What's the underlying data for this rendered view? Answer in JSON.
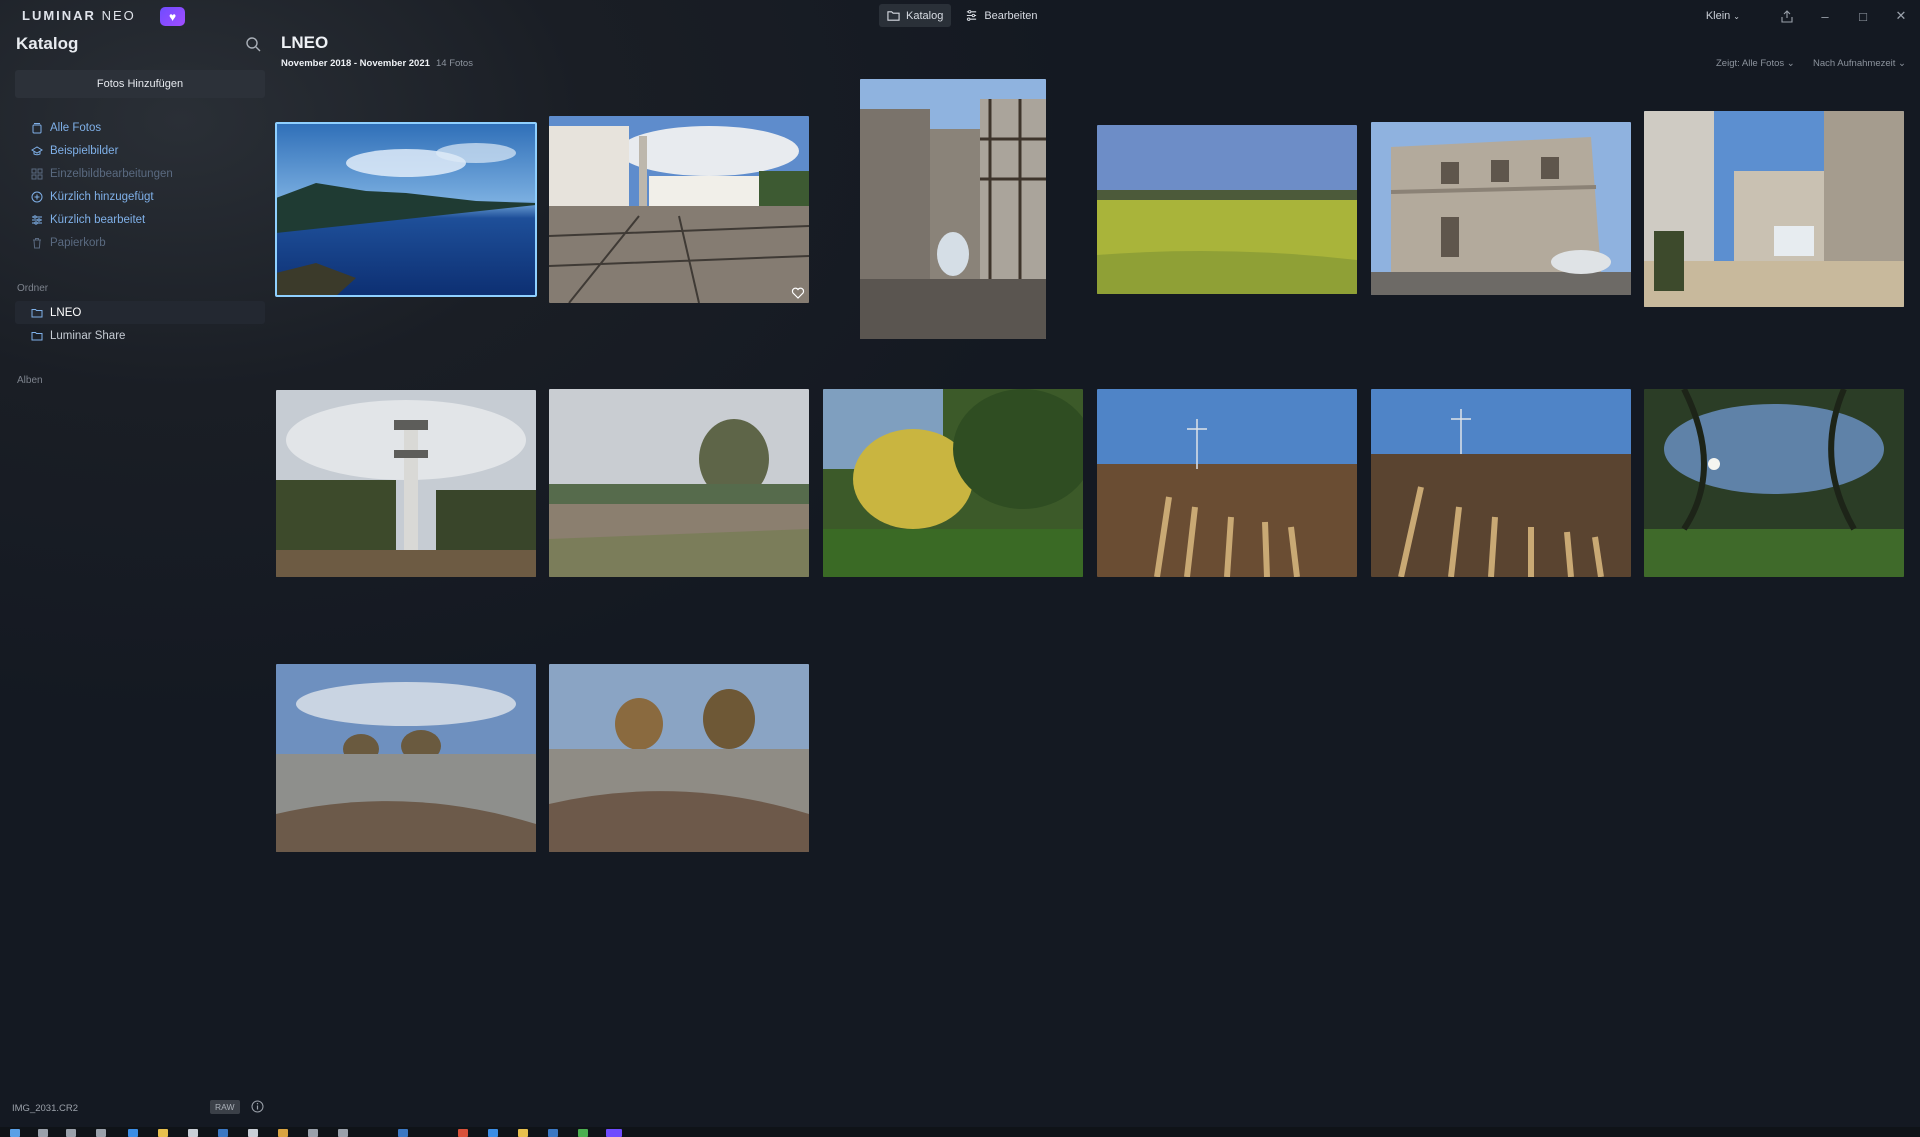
{
  "app": {
    "logo_main": "LUMINAR",
    "logo_neo": "NEO",
    "modes": [
      {
        "label": "Katalog",
        "icon": "folder-icon",
        "active": true
      },
      {
        "label": "Bearbeiten",
        "icon": "sliders-icon",
        "active": false
      }
    ],
    "view_size": "Klein",
    "window_controls": [
      "share-icon",
      "minimize-icon",
      "maximize-icon",
      "close-icon"
    ]
  },
  "sidebar": {
    "title": "Katalog",
    "add_button": "Fotos Hinzufügen",
    "nav_items": [
      {
        "label": "Alle Fotos",
        "icon": "stack-icon",
        "enabled": true
      },
      {
        "label": "Beispielbilder",
        "icon": "graduation-icon",
        "enabled": true
      },
      {
        "label": "Einzelbildbearbeitungen",
        "icon": "grid-icon",
        "enabled": false
      },
      {
        "label": "Kürzlich hinzugefügt",
        "icon": "plus-circle-icon",
        "enabled": true
      },
      {
        "label": "Kürzlich bearbeitet",
        "icon": "sliders-icon",
        "enabled": true
      },
      {
        "label": "Papierkorb",
        "icon": "trash-icon",
        "enabled": false
      }
    ],
    "folders_label": "Ordner",
    "folders": [
      {
        "label": "LNEO",
        "active": true
      },
      {
        "label": "Luminar Share",
        "active": false
      }
    ],
    "albums_label": "Alben",
    "status_file": "IMG_2031.CR2",
    "status_badge": "RAW"
  },
  "main": {
    "title": "LNEO",
    "date_range": "November 2018 - November 2021",
    "photo_count": "14 Fotos",
    "filter_label": "Zeigt: Alle Fotos",
    "sort_label": "Nach Aufnahmezeit",
    "photos": [
      {
        "name": "coast-cliffs",
        "selected": true,
        "favorite": false
      },
      {
        "name": "monastery-plaza",
        "selected": false,
        "favorite": true
      },
      {
        "name": "castle-gate",
        "selected": false,
        "favorite": false
      },
      {
        "name": "rapeseed-field",
        "selected": false,
        "favorite": false
      },
      {
        "name": "old-building",
        "selected": false,
        "favorite": false
      },
      {
        "name": "village-street",
        "selected": false,
        "favorite": false
      },
      {
        "name": "observation-tower",
        "selected": false,
        "favorite": false
      },
      {
        "name": "heath-tree",
        "selected": false,
        "favorite": false
      },
      {
        "name": "autumn-forest",
        "selected": false,
        "favorite": false
      },
      {
        "name": "stubble-field-1",
        "selected": false,
        "favorite": false
      },
      {
        "name": "stubble-field-2",
        "selected": false,
        "favorite": false
      },
      {
        "name": "park-trees",
        "selected": false,
        "favorite": false
      },
      {
        "name": "frosty-heath-1",
        "selected": false,
        "favorite": false
      },
      {
        "name": "frosty-heath-2",
        "selected": false,
        "favorite": false
      }
    ]
  },
  "colors": {
    "accent": "#8fd0ff",
    "nav_link": "#7fb0e8",
    "logo_badge": "#7b4dff"
  }
}
